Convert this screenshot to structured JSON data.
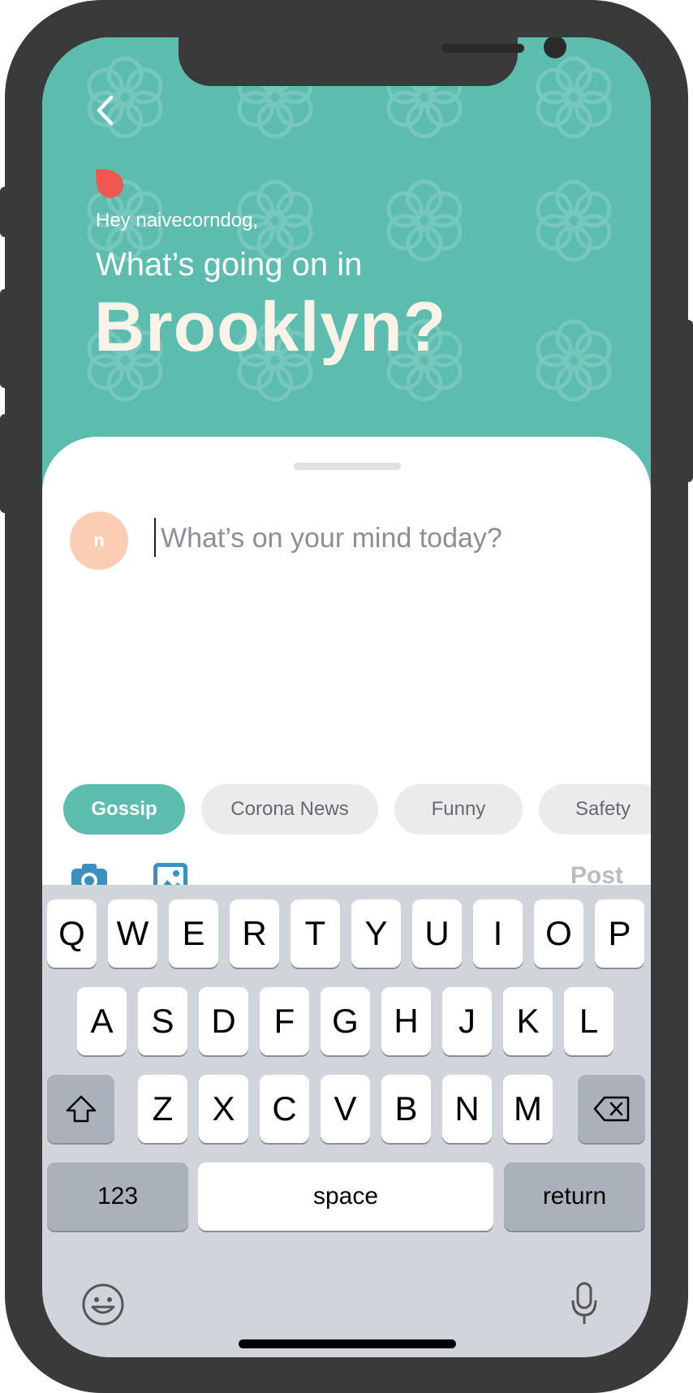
{
  "header": {
    "greeting": "Hey naivecorndog,",
    "subheading": "What’s going on in",
    "city": "Brooklyn?",
    "background_color": "#5cbcae"
  },
  "composer": {
    "avatar_initial": "n",
    "placeholder": "What’s on your mind today?"
  },
  "chips": [
    {
      "label": "Gossip",
      "selected": true
    },
    {
      "label": "Corona News",
      "selected": false
    },
    {
      "label": "Funny",
      "selected": false
    },
    {
      "label": "Safety",
      "selected": false
    }
  ],
  "toolbar": {
    "camera_icon": "camera-icon",
    "photo_icon": "photo-library-icon",
    "post_label": "Post"
  },
  "keyboard": {
    "row1": [
      "Q",
      "W",
      "E",
      "R",
      "T",
      "Y",
      "U",
      "I",
      "O",
      "P"
    ],
    "row2": [
      "A",
      "S",
      "D",
      "F",
      "G",
      "H",
      "J",
      "K",
      "L"
    ],
    "row3": [
      "Z",
      "X",
      "C",
      "V",
      "B",
      "N",
      "M"
    ],
    "numbers_label": "123",
    "space_label": "space",
    "return_label": "return"
  },
  "colors": {
    "accent": "#5cbcae",
    "leaf": "#f0584f",
    "avatar": "#fccdb5",
    "icon_blue": "#3d8fbf",
    "post_disabled": "#b9bdc2"
  }
}
